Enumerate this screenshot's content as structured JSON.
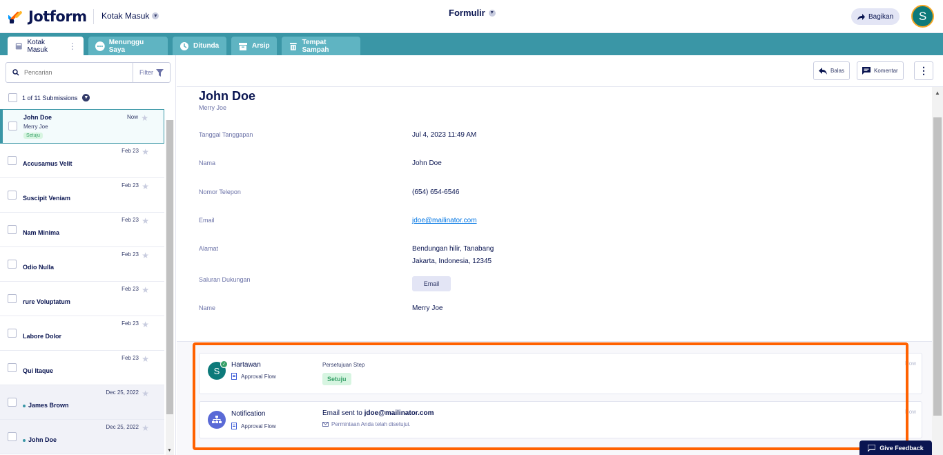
{
  "app": {
    "logo_text": "Jotform",
    "inbox_switch": "Kotak Masuk",
    "form_title": "Formulir",
    "share_label": "Bagikan",
    "user_initial": "S"
  },
  "tabs": [
    {
      "label": "Kotak Masuk",
      "icon": "inbox-icon"
    },
    {
      "label": "Menunggu Saya",
      "icon": "ellipsis-icon"
    },
    {
      "label": "Ditunda",
      "icon": "clock-icon"
    },
    {
      "label": "Arsip",
      "icon": "archive-icon"
    },
    {
      "label": "Tempat Sampah",
      "icon": "trash-icon"
    }
  ],
  "search": {
    "placeholder": "Pencarian",
    "filter_label": "Filter"
  },
  "list_header": {
    "count": "1 of 11 Submissions"
  },
  "submissions": [
    {
      "name": "John Doe",
      "sub": "Merry Joe",
      "badge": "Setuju",
      "date": "Now"
    },
    {
      "name": "Accusamus Velit",
      "date": "Feb 23"
    },
    {
      "name": "Suscipit Veniam",
      "date": "Feb 23"
    },
    {
      "name": "Nam Minima",
      "date": "Feb 23"
    },
    {
      "name": "Odio Nulla",
      "date": "Feb 23"
    },
    {
      "name": "rure Voluptatum",
      "date": "Feb 23"
    },
    {
      "name": "Labore Dolor",
      "date": "Feb 23"
    },
    {
      "name": "Qui Itaque",
      "date": "Feb 23"
    },
    {
      "name": "James Brown",
      "date": "Dec 25, 2022"
    },
    {
      "name": "John Doe",
      "date": "Dec 25, 2022"
    }
  ],
  "toolbar": {
    "reply": "Balas",
    "comment": "Komentar"
  },
  "detail": {
    "title": "John Doe",
    "subtitle": "Merry Joe",
    "fields": {
      "date_label": "Tanggal Tanggapan",
      "date_value": "Jul 4, 2023 11:49 AM",
      "name_label": "Nama",
      "name_value": "John Doe",
      "phone_label": "Nomor Telepon",
      "phone_value": "(654) 654-6546",
      "email_label": "Email",
      "email_value": "jdoe@mailinator.com",
      "address_label": "Alamat",
      "address_line1": "Bendungan hilir, Tanabang",
      "address_line2": "Jakarta, Indonesia, 12345",
      "channel_label": "Saluran Dukungan",
      "channel_value": "Email",
      "name2_label": "Name",
      "name2_value": "Merry Joe"
    }
  },
  "flow": {
    "approver": {
      "initial": "S",
      "name": "Hartawan",
      "sub": "Approval Flow",
      "step": "Persetujuan Step",
      "status": "Setuju",
      "time": "Now"
    },
    "notification": {
      "name": "Notification",
      "sub": "Approval Flow",
      "email_prefix": "Email sent to",
      "email": "jdoe@mailinator.com",
      "message": "Permintaan Anda telah disetujui.",
      "time": "Now"
    }
  },
  "feedback_label": "Give Feedback",
  "colors": {
    "brand": "#0a1551",
    "teal": "#3a96a6",
    "highlight": "#ff6100",
    "approve": "#38a169"
  }
}
